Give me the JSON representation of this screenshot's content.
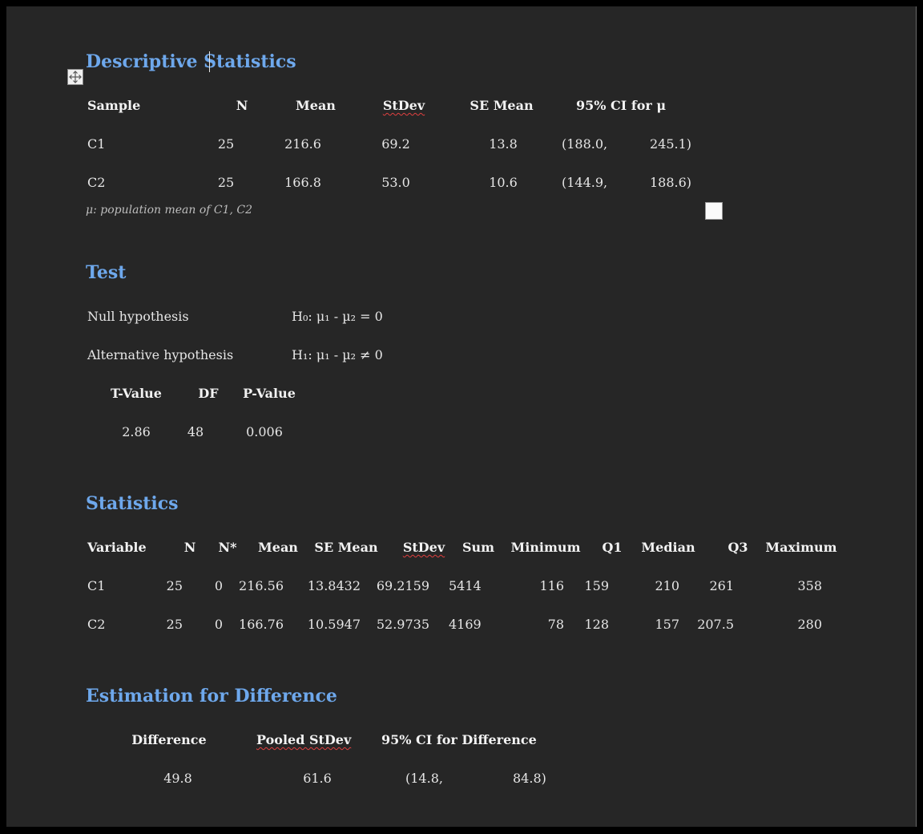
{
  "descriptive": {
    "title": "Descriptive Statistics",
    "headers": [
      "Sample",
      "N",
      "Mean",
      "StDev",
      "SE Mean",
      "95% CI for μ"
    ],
    "rows": [
      {
        "sample": "C1",
        "n": "25",
        "mean": "216.6",
        "stdev": "69.2",
        "se_mean": "13.8",
        "ci_low": "(188.0,",
        "ci_high": "245.1)"
      },
      {
        "sample": "C2",
        "n": "25",
        "mean": "166.8",
        "stdev": "53.0",
        "se_mean": "10.6",
        "ci_low": "(144.9,",
        "ci_high": "188.6)"
      }
    ],
    "note": "μ: population mean of C1, C2"
  },
  "test": {
    "title": "Test",
    "null_label": "Null hypothesis",
    "null_value": "H₀: μ₁ - µ₂ = 0",
    "alt_label": "Alternative hypothesis",
    "alt_value": "H₁: μ₁ - µ₂ ≠ 0",
    "headers": [
      "T-Value",
      "DF",
      "P-Value"
    ],
    "values": [
      "2.86",
      "48",
      "0.006"
    ]
  },
  "statistics": {
    "title": "Statistics",
    "headers": [
      "Variable",
      "N",
      "N*",
      "Mean",
      "SE Mean",
      "StDev",
      "Sum",
      "Minimum",
      "Q1",
      "Median",
      "Q3",
      "Maximum"
    ],
    "rows": [
      [
        "C1",
        "25",
        "0",
        "216.56",
        "13.8432",
        "69.2159",
        "5414",
        "116",
        "159",
        "210",
        "261",
        "358"
      ],
      [
        "C2",
        "25",
        "0",
        "166.76",
        "10.5947",
        "52.9735",
        "4169",
        "78",
        "128",
        "157",
        "207.5",
        "280"
      ]
    ]
  },
  "estimation": {
    "title": "Estimation for Difference",
    "headers": [
      "Difference",
      "Pooled StDev",
      "95% CI for Difference"
    ],
    "difference": "49.8",
    "pooled_stdev": "61.6",
    "ci_low": "(14.8,",
    "ci_high": "84.8)"
  },
  "icons": {
    "move_handle": "move-arrows-icon",
    "checkbox": "checkbox-icon"
  },
  "colors": {
    "heading": "#6ea8ec",
    "page_bg": "#262626",
    "spell_underline": "#e04040"
  }
}
